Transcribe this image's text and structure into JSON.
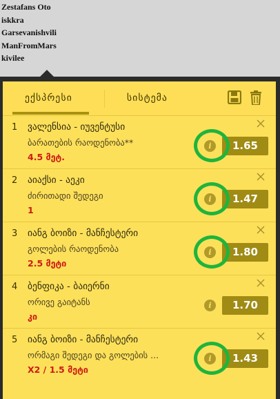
{
  "users": [
    "Zestafans Oto",
    "iskkra",
    "Garsevanishvili",
    "ManFromMars",
    "kivilee"
  ],
  "tabs": {
    "express": "ექსპრესი",
    "system": "სისტემა"
  },
  "bets": [
    {
      "num": "1",
      "match": "ვალენსია - იუვენტუსი",
      "market": "ბარათების რაოდენობა**",
      "pick": "4.5 მეტ.",
      "odds": "1.65",
      "highlighted": true
    },
    {
      "num": "2",
      "match": "აიაქსი - აეკი",
      "market": "ძირითადი შედეგი",
      "pick": "1",
      "odds": "1.47",
      "highlighted": true
    },
    {
      "num": "3",
      "match": "იანგ ბოიზი - მანჩესტერი",
      "market": "გოლების რაოდენობა",
      "pick": "2.5 მეტი",
      "odds": "1.80",
      "highlighted": true
    },
    {
      "num": "4",
      "match": "ბენფიკა - ბაიერნი",
      "market": "ორივე გაიტანს",
      "pick": "კი",
      "odds": "1.70",
      "highlighted": false
    },
    {
      "num": "5",
      "match": "იანგ ბოიზი - მანჩესტერი",
      "market": "ორმაგი შედეგი და გოლების ...",
      "pick": "X2 / 1.5 მეტი",
      "odds": "1.43",
      "highlighted": true
    }
  ],
  "colors": {
    "panel_bg": "#fde05a",
    "odds_bg": "#a08b14",
    "pick_text": "#cc1a12",
    "highlight_ring": "#1fb43c",
    "frame": "#2b2b2b"
  },
  "icons": {
    "save": "floppy-disk",
    "trash": "trash-can",
    "info": "info-circle",
    "close": "x-mark"
  }
}
